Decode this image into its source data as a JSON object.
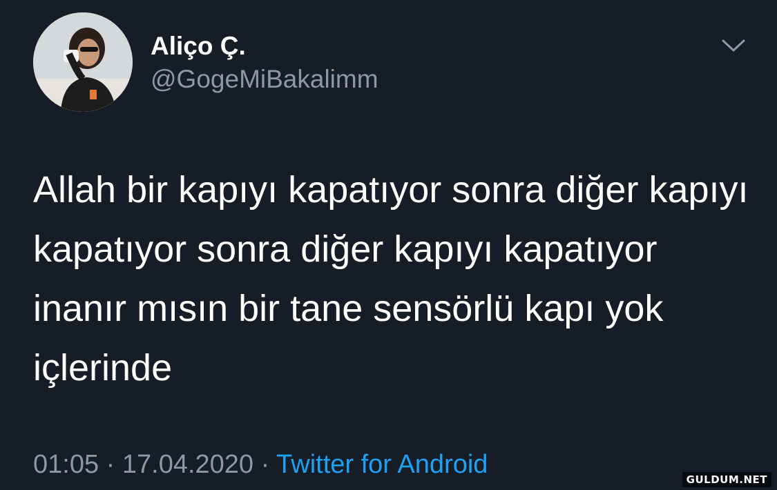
{
  "user": {
    "display_name": "Aliço Ç.",
    "handle": "@GogeMiBakalimm",
    "avatar_icon": "profile-photo"
  },
  "tweet": {
    "text": "Allah bir kapıyı kapatıyor sonra diğer kapıyı kapatıyor sonra diğer kapıyı kapatıyor inanır mısın bir tane sensörlü kapı yok içlerinde",
    "time": "01:05",
    "separator": "·",
    "date": "17.04.2020",
    "source": "Twitter for Android"
  },
  "controls": {
    "menu_icon": "chevron-down-icon"
  },
  "watermark": "GULDUM.NET",
  "colors": {
    "background": "#161d27",
    "text": "#ffffff",
    "muted": "#8b98a5",
    "accent": "#1da1f2"
  }
}
